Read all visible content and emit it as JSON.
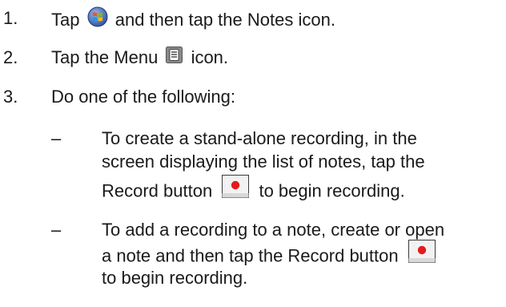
{
  "steps": [
    {
      "number": "1.",
      "before": "Tap",
      "after": "and then tap the Notes icon."
    },
    {
      "number": "2.",
      "before": "Tap the Menu",
      "after": "icon."
    },
    {
      "number": "3.",
      "text": "Do one of the following:"
    }
  ],
  "bullets": [
    {
      "dash": "–",
      "line1": "To create a stand-alone recording, in the",
      "line2": "screen displaying the list of notes, tap the",
      "line3_before": "Record button",
      "line3_after": "to begin recording."
    },
    {
      "dash": "–",
      "line1": "To add a recording to a note, create or open",
      "line2_before": "a note and then tap the Record button",
      "line3": "to begin recording."
    }
  ],
  "icons": {
    "start": "windows-start-icon",
    "menu": "menu-icon",
    "record": "record-button-icon",
    "record_color": "#e31b1b"
  }
}
